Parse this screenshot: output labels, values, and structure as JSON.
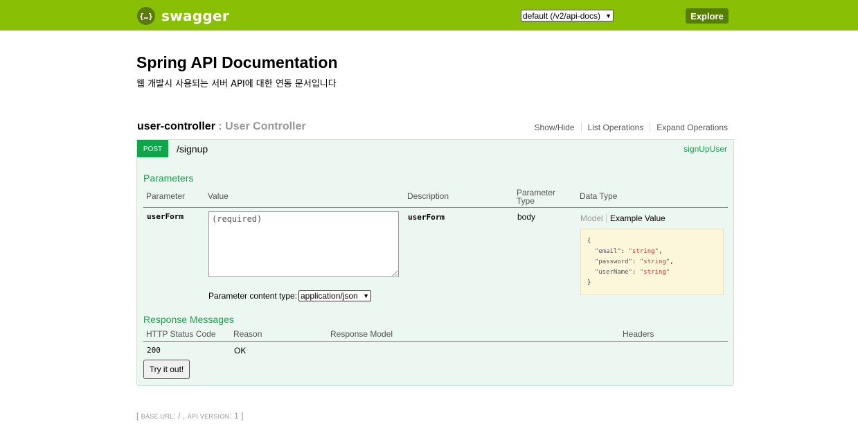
{
  "header": {
    "logo_glyph": "{…}",
    "logo_text": "swagger",
    "spec_select": "default (/v2/api-docs)",
    "explore_label": "Explore"
  },
  "info": {
    "title": "Spring API Documentation",
    "description": "웹 개발시 사용되는 서버 API에 대한 연동 문서입니다"
  },
  "controller": {
    "name": "user-controller",
    "separator": " : ",
    "description": "User Controller",
    "links": [
      "Show/Hide",
      "List Operations",
      "Expand Operations"
    ]
  },
  "operation": {
    "method": "POST",
    "path": "/signup",
    "nickname": "signUpUser",
    "parameters_title": "Parameters",
    "param_headers": {
      "parameter": "Parameter",
      "value": "Value",
      "description": "Description",
      "parameter_type_line1": "Parameter",
      "parameter_type_line2": "Type",
      "data_type": "Data Type"
    },
    "param_row": {
      "name": "userForm",
      "value_placeholder": "(required)",
      "description": "userForm",
      "param_type": "body"
    },
    "content_type_label": "Parameter content type:",
    "content_type_value": "application/json",
    "model_tab": "Model",
    "example_tab": "Example Value",
    "example_json": {
      "open": "{",
      "lines": [
        {
          "key": "\"email\"",
          "value": "\"string\"",
          "comma": ","
        },
        {
          "key": "\"password\"",
          "value": "\"string\"",
          "comma": ","
        },
        {
          "key": "\"userName\"",
          "value": "\"string\"",
          "comma": ""
        }
      ],
      "close": "}"
    },
    "responses_title": "Response Messages",
    "response_headers": {
      "status": "HTTP Status Code",
      "reason": "Reason",
      "model": "Response Model",
      "headers": "Headers"
    },
    "response_row": {
      "status": "200",
      "reason": "OK"
    },
    "try_label": "Try it out!"
  },
  "footer": {
    "open": "[ ",
    "base_url_label": "BASE URL",
    "base_url_value": ": / , ",
    "api_version_label": "API VERSION",
    "api_version_value": ": 1 ",
    "close": "]"
  }
}
